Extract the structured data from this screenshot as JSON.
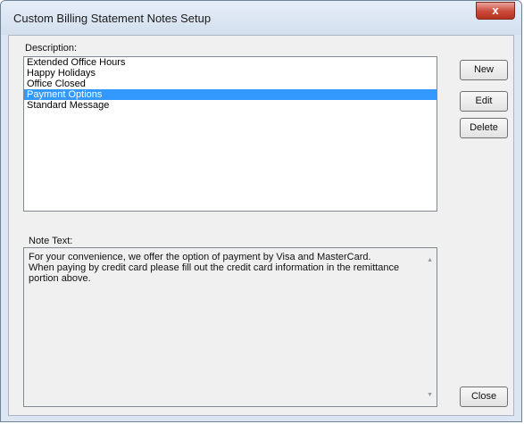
{
  "window": {
    "title": "Custom Billing Statement Notes Setup",
    "close_glyph": "x"
  },
  "description": {
    "label": "Description:",
    "items": [
      "Extended Office Hours",
      "Happy Holidays",
      "Office Closed",
      "Payment Options",
      "Standard Message"
    ],
    "selected_index": 3
  },
  "buttons": {
    "new_label": "New",
    "edit_label": "Edit",
    "delete_label": "Delete",
    "close_label": "Close"
  },
  "note": {
    "label": "Note Text:",
    "text_lines": [
      "For your convenience, we offer the option of payment by Visa and MasterCard.",
      "When paying by credit card please fill out the credit card information in the remittance",
      "portion above."
    ],
    "scroll_up_icon": "scroll-up-arrow-icon",
    "scroll_down_icon": "scroll-down-arrow-icon"
  },
  "colors": {
    "selection": "#3399ff",
    "close_button": "#c9493a"
  }
}
